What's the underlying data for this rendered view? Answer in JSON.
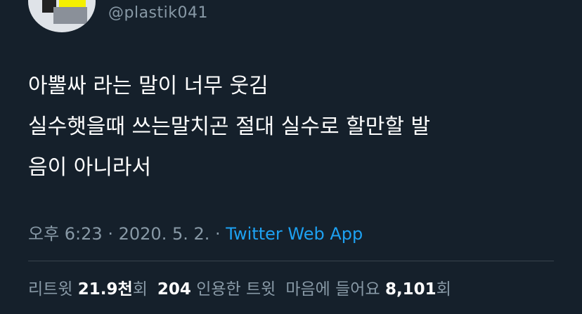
{
  "author": {
    "handle": "@plastik041"
  },
  "tweet": {
    "lines": [
      "아뿔싸 라는 말이 너무 웃김",
      "실수햇을때 쓰는말치곤 절대 실수로 할만할 발",
      "음이 아니라서"
    ]
  },
  "meta": {
    "time": "오후 6:23",
    "separator": "·",
    "date": "2020. 5. 2.",
    "source": "Twitter Web App"
  },
  "stats": {
    "retweets_label": "리트윗",
    "retweets_value": "21.9천",
    "retweets_suffix": "회",
    "quotes_value": "204",
    "quotes_label": "인용한 트윗",
    "likes_label": "마음에 들어요",
    "likes_value": "8,101",
    "likes_suffix": "회"
  },
  "colors": {
    "background": "#15202b",
    "secondary_text": "#8899a6",
    "link": "#1da1f2"
  }
}
